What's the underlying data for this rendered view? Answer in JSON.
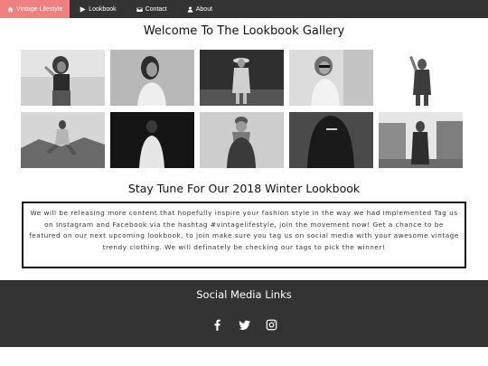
{
  "nav": {
    "items": [
      {
        "label": "Vintage Lifestyle",
        "icon": "home-icon",
        "active": true
      },
      {
        "label": "Lookbook",
        "icon": "play-icon",
        "active": false
      },
      {
        "label": "Contact",
        "icon": "envelope-icon",
        "active": false
      },
      {
        "label": "About",
        "icon": "user-icon",
        "active": false
      }
    ],
    "active_color": "#f08080",
    "bar_color": "#333333"
  },
  "gallery": {
    "title": "Welcome To The Lookbook Gallery",
    "photos": [
      {
        "icon": "photo-woman-sunglasses"
      },
      {
        "icon": "photo-woman-portrait"
      },
      {
        "icon": "photo-woman-hat-bag"
      },
      {
        "icon": "photo-woman-sunglasses-smile"
      },
      {
        "icon": "photo-man-hands-up"
      },
      {
        "icon": "photo-man-sitting-rocks"
      },
      {
        "icon": "photo-man-dark-shirt"
      },
      {
        "icon": "photo-man-beanie-scarf"
      },
      {
        "icon": "photo-man-black-tee"
      },
      {
        "icon": "photo-man-coat-city"
      }
    ]
  },
  "announcement": {
    "title": "Stay Tune For Our 2018 Winter Lookbook",
    "text": "We will be releasing more content that hopefully inspire your fashion style in the way we had implemented Tag us on Instagram and Facebook via the hashtag #vintagelifestyle, join the movement now! Get a chance to be featured on our next upcoming lookbook, to join make sure you tag us on social media with your awesome vintage trendy clothing. We will definately be checking our tags to pick the winner!"
  },
  "footer": {
    "title": "Social Media Links",
    "icons": [
      "facebook-icon",
      "twitter-icon",
      "instagram-icon"
    ],
    "background": "#333333"
  }
}
